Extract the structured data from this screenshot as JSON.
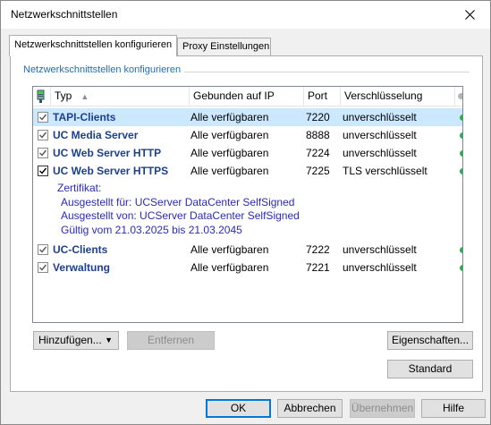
{
  "window": {
    "title": "Netzwerkschnittstellen"
  },
  "tabs": [
    {
      "label": "Netzwerkschnittstellen konfigurieren",
      "active": true
    },
    {
      "label": "Proxy Einstellungen",
      "active": false
    }
  ],
  "group": {
    "title": "Netzwerkschnittstellen konfigurieren"
  },
  "list": {
    "headers": {
      "icon": "network-icon",
      "type": "Typ",
      "bound": "Gebunden auf IP",
      "port": "Port",
      "encryption": "Verschlüsselung",
      "status": "status-dot"
    },
    "rows": [
      {
        "name": "TAPI-Clients",
        "bound": "Alle verfügbaren",
        "port": "7220",
        "encryption": "unverschlüsselt",
        "checked": true,
        "selected": true,
        "status_color": "#22b14c"
      },
      {
        "name": "UC Media Server",
        "bound": "Alle verfügbaren",
        "port": "8888",
        "encryption": "unverschlüsselt",
        "checked": true,
        "selected": false,
        "status_color": "#22b14c"
      },
      {
        "name": "UC Web Server HTTP",
        "bound": "Alle verfügbaren",
        "port": "7224",
        "encryption": "unverschlüsselt",
        "checked": true,
        "selected": false,
        "status_color": "#22b14c"
      },
      {
        "name": "UC Web Server HTTPS",
        "bound": "Alle verfügbaren",
        "port": "7225",
        "encryption": "TLS verschlüsselt",
        "checked": true,
        "selected": false,
        "status_color": "#22b14c"
      },
      {
        "name": "UC-Clients",
        "bound": "Alle verfügbaren",
        "port": "7222",
        "encryption": "unverschlüsselt",
        "checked": true,
        "selected": false,
        "status_color": "#22b14c"
      },
      {
        "name": "Verwaltung",
        "bound": "Alle verfügbaren",
        "port": "7221",
        "encryption": "unverschlüsselt",
        "checked": true,
        "selected": false,
        "status_color": "#22b14c"
      }
    ],
    "certificate": {
      "heading": "Zertifikat:",
      "issued_for": "Ausgestellt für: UCServer DataCenter SelfSigned",
      "issued_by": "Ausgestellt von: UCServer DataCenter SelfSigned",
      "validity": "Gültig vom 21.03.2025 bis 21.03.2045"
    }
  },
  "buttons": {
    "add": "Hinzufügen...",
    "remove": "Entfernen",
    "properties": "Eigenschaften...",
    "standard": "Standard",
    "ok": "OK",
    "cancel": "Abbrechen",
    "apply": "Übernehmen",
    "help": "Hilfe"
  },
  "colors": {
    "accent": "#1c6fb5",
    "selection": "#cce8ff",
    "status_ok": "#22b14c",
    "name_text": "#1c3f8f",
    "cert_text": "#2a2ab8"
  }
}
